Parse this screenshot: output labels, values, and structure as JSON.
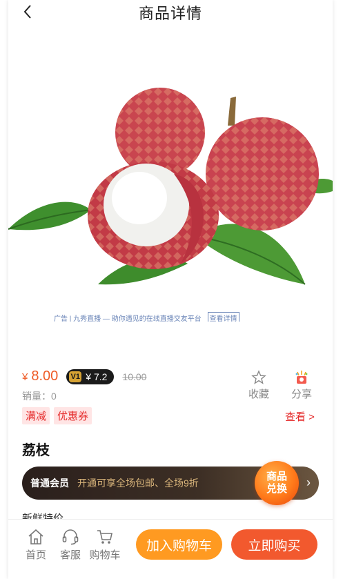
{
  "header": {
    "title": "商品详情"
  },
  "ad": {
    "text": "广告 | 九秀直播 — 助你遇见的在线直播交友平台",
    "tag": "查看详情"
  },
  "price": {
    "currency": "¥",
    "current": "8.00",
    "vip_price": "¥ 7.2",
    "vip_badge": "V1",
    "original": "10.00"
  },
  "sales": "销量：0",
  "actions": {
    "favorite": "收藏",
    "share": "分享"
  },
  "promo_tags": [
    "满减",
    "优惠券"
  ],
  "view_all": "查看 >",
  "product": {
    "name": "荔枝"
  },
  "member": {
    "level": "普通会员",
    "desc": "开通可享全场包邮、全场9折",
    "chevron": "›"
  },
  "redeem": {
    "line1": "商品",
    "line2": "兑换"
  },
  "section_sub": "新鲜特价",
  "bottom_nav": {
    "home": "首页",
    "service": "客服",
    "cart": "购物车"
  },
  "buttons": {
    "add_cart": "加入购物车",
    "buy_now": "立即购买"
  },
  "colors": {
    "accent_orange": "#ff9a21",
    "accent_red": "#f2592e",
    "price_red": "#ee5a25"
  }
}
